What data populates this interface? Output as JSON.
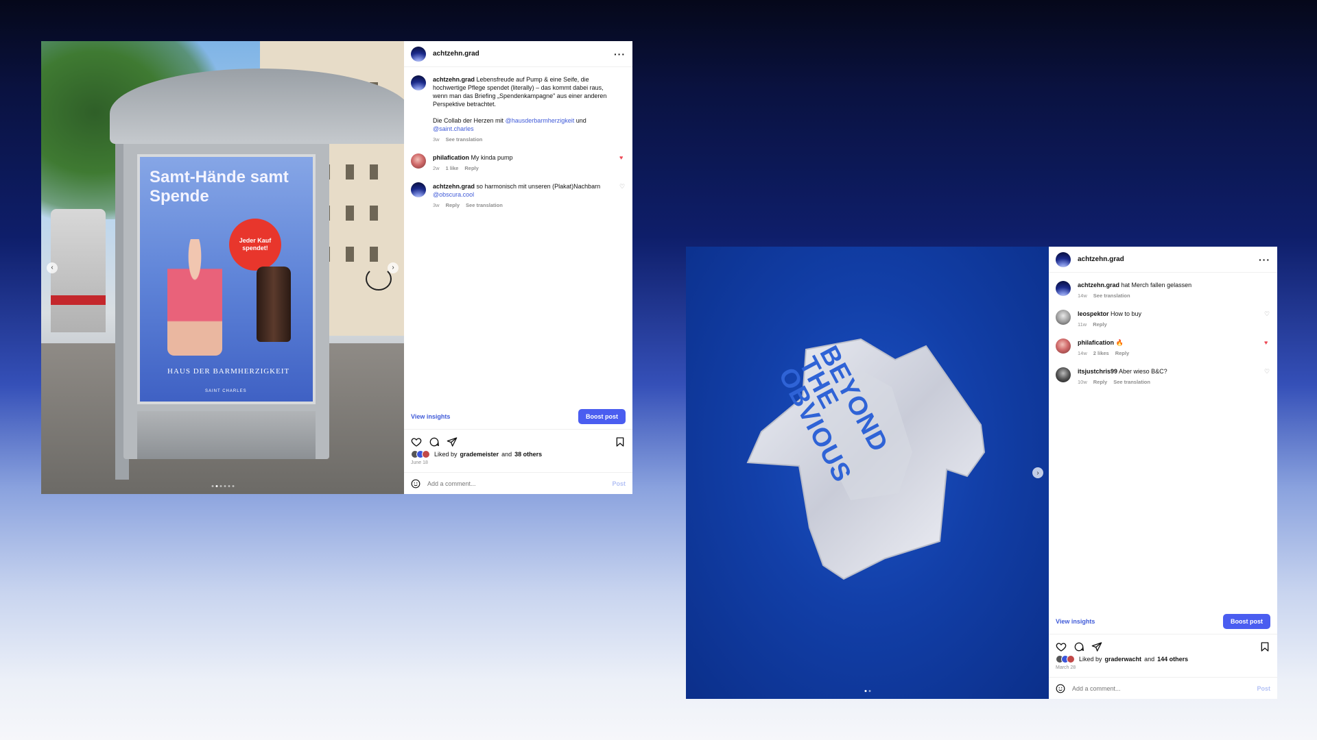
{
  "post1": {
    "username": "achtzehn.grad",
    "more_icon": "more-horizontal-icon",
    "poster_title": "Samt-Hände samt Spende",
    "poster_badge": "Jeder Kauf spendet!",
    "poster_footer": "HAUS DER BARMHERZIGKEIT",
    "poster_logo": "SAINT CHARLES",
    "caption": {
      "username": "achtzehn.grad",
      "text": "Lebensfreude auf Pump & eine Seife, die hochwertige Pflege spendet (literally) – das kommt dabei raus, wenn man das Briefing „Spendenkampagne\" aus einer anderen Perspektive betrachtet.",
      "text2": "Die Collab der Herzen mit",
      "mention1": "@hausderbarmherzigkeit",
      "and": "und",
      "mention2": "@saint.charles",
      "time": "3w",
      "translate": "See translation"
    },
    "comments": [
      {
        "username": "philafication",
        "text": "My kinda pump",
        "time": "2w",
        "likes": "1 like",
        "reply": "Reply",
        "liked": true
      },
      {
        "username": "achtzehn.grad",
        "text": "so harmonisch mit unseren (Plakat)Nachbarn",
        "mention": "@obscura.cool",
        "time": "3w",
        "reply": "Reply",
        "translate": "See translation",
        "liked": false
      }
    ],
    "view_insights": "View insights",
    "boost_post": "Boost post",
    "liked_by_prefix": "Liked by",
    "liked_by_user": "grademeister",
    "liked_by_and": "and",
    "liked_by_others": "38 others",
    "date": "June 18",
    "comment_placeholder": "Add a comment...",
    "post_button": "Post"
  },
  "post2": {
    "username": "achtzehn.grad",
    "more_icon": "more-horizontal-icon",
    "shirt_text": "BEYOND THE OBVIOUS",
    "comments": [
      {
        "username": "achtzehn.grad",
        "text": "hat Merch fallen gelassen",
        "time": "14w",
        "translate": "See translation"
      },
      {
        "username": "leospektor",
        "text": "How to buy",
        "time": "11w",
        "reply": "Reply",
        "liked": false
      },
      {
        "username": "philafication",
        "text": "🔥",
        "time": "14w",
        "likes": "2 likes",
        "reply": "Reply",
        "liked": true
      },
      {
        "username": "itsjustchris99",
        "text": "Aber wieso B&C?",
        "time": "10w",
        "reply": "Reply",
        "translate": "See translation",
        "liked": false
      }
    ],
    "view_insights": "View insights",
    "boost_post": "Boost post",
    "liked_by_prefix": "Liked by",
    "liked_by_user": "graderwacht",
    "liked_by_and": "and",
    "liked_by_others": "144 others",
    "date": "March 28",
    "comment_placeholder": "Add a comment...",
    "post_button": "Post"
  },
  "colors": {
    "accent": "#4a5df0",
    "link": "#3f5ad8",
    "heart_liked": "#ed4956"
  }
}
